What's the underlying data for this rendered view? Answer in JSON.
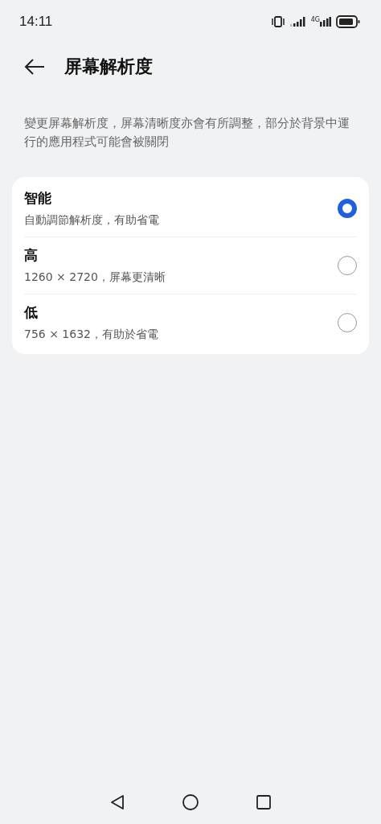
{
  "status_bar": {
    "time": "14:11",
    "network": "4G"
  },
  "header": {
    "title": "屏幕解析度"
  },
  "description": "變更屏幕解析度，屏幕清晰度亦會有所調整，部分於背景中運行的應用程式可能會被關閉",
  "options": [
    {
      "label": "智能",
      "detail": "自動調節解析度，有助省電",
      "selected": true
    },
    {
      "label": "高",
      "detail": "1260 × 2720，屏幕更清晰",
      "selected": false
    },
    {
      "label": "低",
      "detail": "756 × 1632，有助於省電",
      "selected": false
    }
  ]
}
